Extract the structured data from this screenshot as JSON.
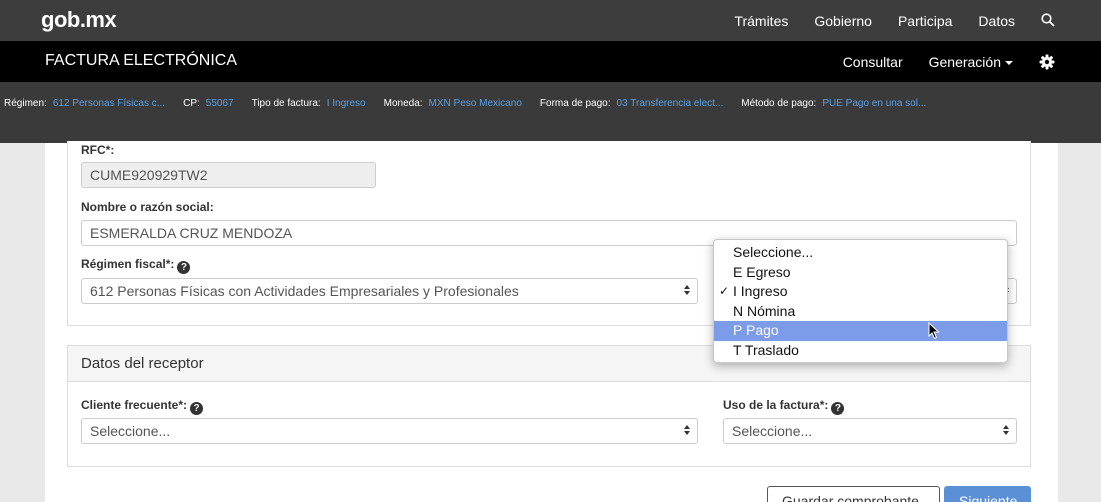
{
  "header": {
    "logo": "gob.mx",
    "nav": [
      "Trámites",
      "Gobierno",
      "Participa",
      "Datos"
    ]
  },
  "appbar": {
    "title": "FACTURA ELECTRÓNICA",
    "consultar": "Consultar",
    "generacion": "Generación"
  },
  "infobar": {
    "regimen_label": "Régimen:",
    "regimen_value": "612 Personas Físicas c...",
    "cp_label": "CP:",
    "cp_value": "55067",
    "tipo_label": "Tipo de factura:",
    "tipo_value": "I Ingreso",
    "moneda_label": "Moneda:",
    "moneda_value": "MXN Peso Mexicano",
    "forma_label": "Forma de pago:",
    "forma_value": "03 Transferencia elect...",
    "metodo_label": "Método de pago:",
    "metodo_value": "PUE Pago en una sol..."
  },
  "emisor": {
    "rfc_label": "RFC*:",
    "rfc_value": "CUME920929TW2",
    "nombre_label": "Nombre o razón social:",
    "nombre_value": "ESMERALDA CRUZ MENDOZA",
    "regimen_label": "Régimen fiscal*:",
    "regimen_value": "612 Personas Físicas con Actividades Empresariales y Profesionales"
  },
  "dropdown": {
    "options": [
      "Seleccione...",
      "E Egreso",
      "I Ingreso",
      "N Nómina",
      "P Pago",
      "T Traslado"
    ],
    "checked": "I Ingreso",
    "highlighted": "P Pago",
    "check_mark": "✓"
  },
  "receptor": {
    "title": "Datos del receptor",
    "cliente_label": "Cliente frecuente*:",
    "cliente_value": "Seleccione...",
    "uso_label": "Uso de la factura*:",
    "uso_value": "Seleccione..."
  },
  "footer": {
    "save_label": "Guardar comprobante",
    "next_label": "Siguiente"
  },
  "colors": {
    "topbar": "#3d3d3d",
    "appbar": "#000000",
    "link": "#5aa0e0",
    "highlight": "#7c9be8",
    "primary": "#5b8fd6"
  }
}
